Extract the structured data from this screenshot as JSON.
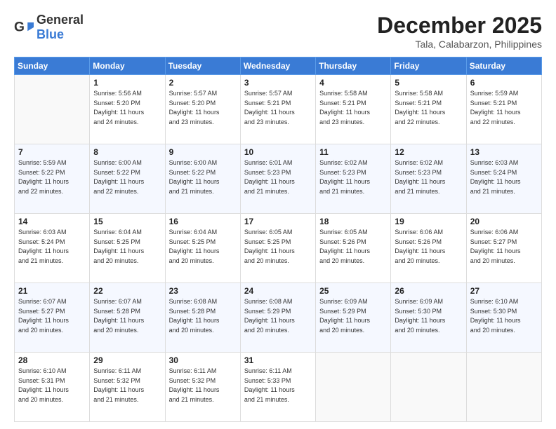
{
  "header": {
    "logo_general": "General",
    "logo_blue": "Blue",
    "month_title": "December 2025",
    "location": "Tala, Calabarzon, Philippines"
  },
  "days_of_week": [
    "Sunday",
    "Monday",
    "Tuesday",
    "Wednesday",
    "Thursday",
    "Friday",
    "Saturday"
  ],
  "weeks": [
    [
      {
        "day": "",
        "info": ""
      },
      {
        "day": "1",
        "info": "Sunrise: 5:56 AM\nSunset: 5:20 PM\nDaylight: 11 hours\nand 24 minutes."
      },
      {
        "day": "2",
        "info": "Sunrise: 5:57 AM\nSunset: 5:20 PM\nDaylight: 11 hours\nand 23 minutes."
      },
      {
        "day": "3",
        "info": "Sunrise: 5:57 AM\nSunset: 5:21 PM\nDaylight: 11 hours\nand 23 minutes."
      },
      {
        "day": "4",
        "info": "Sunrise: 5:58 AM\nSunset: 5:21 PM\nDaylight: 11 hours\nand 23 minutes."
      },
      {
        "day": "5",
        "info": "Sunrise: 5:58 AM\nSunset: 5:21 PM\nDaylight: 11 hours\nand 22 minutes."
      },
      {
        "day": "6",
        "info": "Sunrise: 5:59 AM\nSunset: 5:21 PM\nDaylight: 11 hours\nand 22 minutes."
      }
    ],
    [
      {
        "day": "7",
        "info": "Sunrise: 5:59 AM\nSunset: 5:22 PM\nDaylight: 11 hours\nand 22 minutes."
      },
      {
        "day": "8",
        "info": "Sunrise: 6:00 AM\nSunset: 5:22 PM\nDaylight: 11 hours\nand 22 minutes."
      },
      {
        "day": "9",
        "info": "Sunrise: 6:00 AM\nSunset: 5:22 PM\nDaylight: 11 hours\nand 21 minutes."
      },
      {
        "day": "10",
        "info": "Sunrise: 6:01 AM\nSunset: 5:23 PM\nDaylight: 11 hours\nand 21 minutes."
      },
      {
        "day": "11",
        "info": "Sunrise: 6:02 AM\nSunset: 5:23 PM\nDaylight: 11 hours\nand 21 minutes."
      },
      {
        "day": "12",
        "info": "Sunrise: 6:02 AM\nSunset: 5:23 PM\nDaylight: 11 hours\nand 21 minutes."
      },
      {
        "day": "13",
        "info": "Sunrise: 6:03 AM\nSunset: 5:24 PM\nDaylight: 11 hours\nand 21 minutes."
      }
    ],
    [
      {
        "day": "14",
        "info": "Sunrise: 6:03 AM\nSunset: 5:24 PM\nDaylight: 11 hours\nand 21 minutes."
      },
      {
        "day": "15",
        "info": "Sunrise: 6:04 AM\nSunset: 5:25 PM\nDaylight: 11 hours\nand 20 minutes."
      },
      {
        "day": "16",
        "info": "Sunrise: 6:04 AM\nSunset: 5:25 PM\nDaylight: 11 hours\nand 20 minutes."
      },
      {
        "day": "17",
        "info": "Sunrise: 6:05 AM\nSunset: 5:25 PM\nDaylight: 11 hours\nand 20 minutes."
      },
      {
        "day": "18",
        "info": "Sunrise: 6:05 AM\nSunset: 5:26 PM\nDaylight: 11 hours\nand 20 minutes."
      },
      {
        "day": "19",
        "info": "Sunrise: 6:06 AM\nSunset: 5:26 PM\nDaylight: 11 hours\nand 20 minutes."
      },
      {
        "day": "20",
        "info": "Sunrise: 6:06 AM\nSunset: 5:27 PM\nDaylight: 11 hours\nand 20 minutes."
      }
    ],
    [
      {
        "day": "21",
        "info": "Sunrise: 6:07 AM\nSunset: 5:27 PM\nDaylight: 11 hours\nand 20 minutes."
      },
      {
        "day": "22",
        "info": "Sunrise: 6:07 AM\nSunset: 5:28 PM\nDaylight: 11 hours\nand 20 minutes."
      },
      {
        "day": "23",
        "info": "Sunrise: 6:08 AM\nSunset: 5:28 PM\nDaylight: 11 hours\nand 20 minutes."
      },
      {
        "day": "24",
        "info": "Sunrise: 6:08 AM\nSunset: 5:29 PM\nDaylight: 11 hours\nand 20 minutes."
      },
      {
        "day": "25",
        "info": "Sunrise: 6:09 AM\nSunset: 5:29 PM\nDaylight: 11 hours\nand 20 minutes."
      },
      {
        "day": "26",
        "info": "Sunrise: 6:09 AM\nSunset: 5:30 PM\nDaylight: 11 hours\nand 20 minutes."
      },
      {
        "day": "27",
        "info": "Sunrise: 6:10 AM\nSunset: 5:30 PM\nDaylight: 11 hours\nand 20 minutes."
      }
    ],
    [
      {
        "day": "28",
        "info": "Sunrise: 6:10 AM\nSunset: 5:31 PM\nDaylight: 11 hours\nand 20 minutes."
      },
      {
        "day": "29",
        "info": "Sunrise: 6:11 AM\nSunset: 5:32 PM\nDaylight: 11 hours\nand 21 minutes."
      },
      {
        "day": "30",
        "info": "Sunrise: 6:11 AM\nSunset: 5:32 PM\nDaylight: 11 hours\nand 21 minutes."
      },
      {
        "day": "31",
        "info": "Sunrise: 6:11 AM\nSunset: 5:33 PM\nDaylight: 11 hours\nand 21 minutes."
      },
      {
        "day": "",
        "info": ""
      },
      {
        "day": "",
        "info": ""
      },
      {
        "day": "",
        "info": ""
      }
    ]
  ]
}
